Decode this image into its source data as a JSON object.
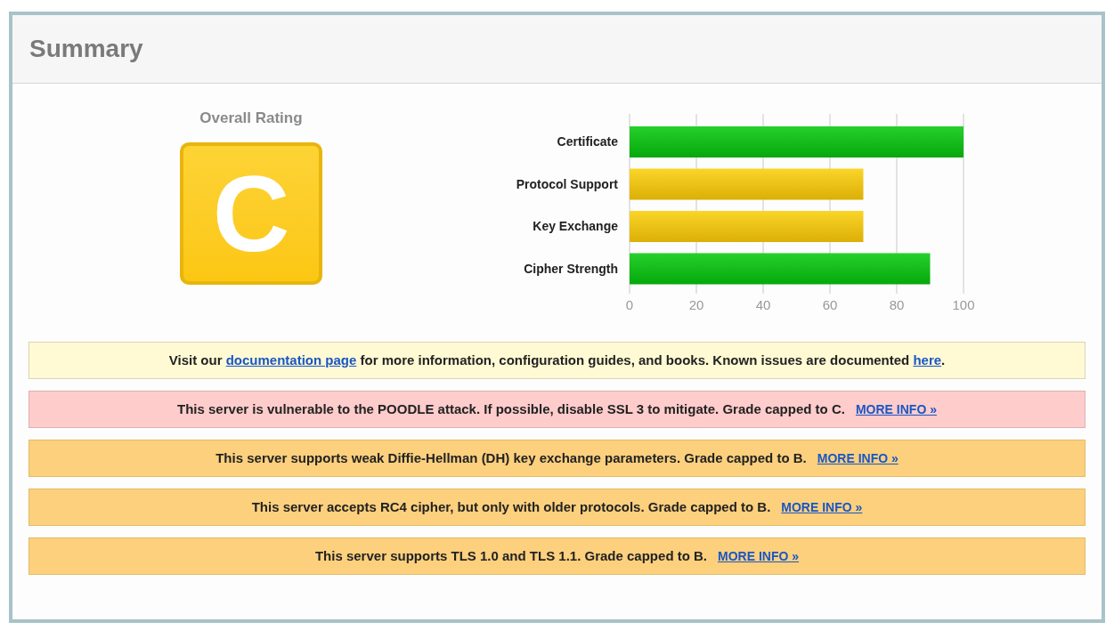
{
  "header": {
    "title": "Summary"
  },
  "rating": {
    "label": "Overall Rating",
    "grade": "C"
  },
  "chart_data": {
    "type": "bar",
    "orientation": "horizontal",
    "categories": [
      "Certificate",
      "Protocol Support",
      "Key Exchange",
      "Cipher Strength"
    ],
    "values": [
      100,
      70,
      70,
      90
    ],
    "grid": true,
    "xlim": [
      0,
      100
    ],
    "xticks": [
      0,
      20,
      40,
      60,
      80,
      100
    ]
  },
  "messages": [
    {
      "kind": "info",
      "parts": [
        {
          "text": "Visit our ",
          "link": false
        },
        {
          "text": "documentation page",
          "link": true
        },
        {
          "text": " for more information, configuration guides, and books. Known issues are documented ",
          "link": false
        },
        {
          "text": "here",
          "link": true
        },
        {
          "text": ".",
          "link": false
        }
      ]
    },
    {
      "kind": "danger",
      "text": "This server is vulnerable to the POODLE attack. If possible, disable SSL 3 to mitigate. Grade capped to C.",
      "link": "MORE INFO »"
    },
    {
      "kind": "warning",
      "text": "This server supports weak Diffie-Hellman (DH) key exchange parameters. Grade capped to B.",
      "link": "MORE INFO »"
    },
    {
      "kind": "warning",
      "text": "This server accepts RC4 cipher, but only with older protocols. Grade capped to B.",
      "link": "MORE INFO »"
    },
    {
      "kind": "warning",
      "text": "This server supports TLS 1.0 and TLS 1.1. Grade capped to B.",
      "link": "MORE INFO »"
    }
  ]
}
